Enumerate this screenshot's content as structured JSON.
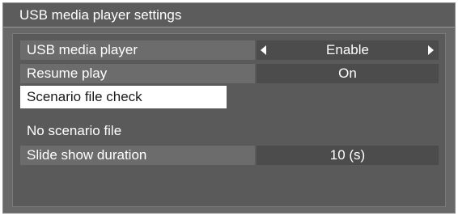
{
  "window": {
    "title": "USB media player settings"
  },
  "rows": [
    {
      "label": "USB media player",
      "value": "Enable"
    },
    {
      "label": "Resume play",
      "value": "On"
    },
    {
      "label": "Scenario file check"
    }
  ],
  "status": {
    "text": "No scenario file"
  },
  "slide_show": {
    "label": "Slide show duration",
    "value": "10 (s)"
  }
}
